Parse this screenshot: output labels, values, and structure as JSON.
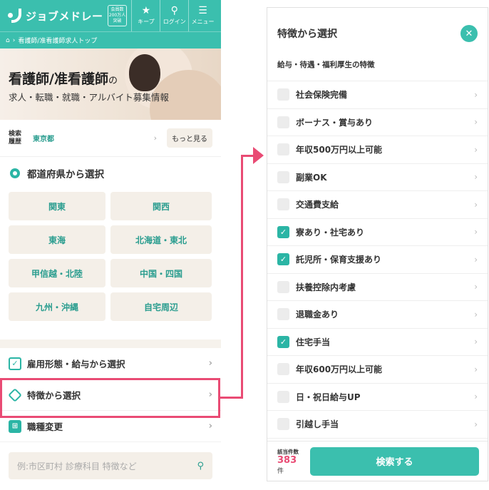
{
  "header": {
    "logo_text": "ジョブメドレー",
    "members_badge": [
      "会員数",
      "200万人",
      "突破"
    ],
    "keep_label": "キープ",
    "login_label": "ログイン",
    "menu_label": "メニュー"
  },
  "breadcrumb": {
    "home_icon": "home-icon",
    "text": "看護師/准看護師求人トップ"
  },
  "hero": {
    "title": "看護師/准看護師",
    "title_suffix": "の",
    "subtitle": "求人・転職・就職・アルバイト募集情報"
  },
  "history": {
    "label_line1": "検索",
    "label_line2": "履歴",
    "value": "東京都",
    "more_label": "もっと見る"
  },
  "prefecture": {
    "title": "都道府県から選択",
    "regions": [
      "関東",
      "関西",
      "東海",
      "北海道・東北",
      "甲信越・北陸",
      "中国・四国",
      "九州・沖縄",
      "自宅周辺"
    ]
  },
  "menu": {
    "employment": "雇用形態・給与から選択",
    "features": "特徴から選択",
    "job_type": "職種変更"
  },
  "search": {
    "placeholder": "例:市区町村 診療科目 特徴など"
  },
  "modal": {
    "title": "特徴から選択",
    "group_title": "給与・待遇・福利厚生の特徴",
    "items": [
      {
        "label": "社会保険完備",
        "checked": false
      },
      {
        "label": "ボーナス・賞与あり",
        "checked": false
      },
      {
        "label": "年収500万円以上可能",
        "checked": false
      },
      {
        "label": "副業OK",
        "checked": false
      },
      {
        "label": "交通費支給",
        "checked": false
      },
      {
        "label": "寮あり・社宅あり",
        "checked": true
      },
      {
        "label": "託児所・保育支援あり",
        "checked": true
      },
      {
        "label": "扶養控除内考慮",
        "checked": false
      },
      {
        "label": "退職金あり",
        "checked": false
      },
      {
        "label": "住宅手当",
        "checked": true
      },
      {
        "label": "年収600万円以上可能",
        "checked": false
      },
      {
        "label": "日・祝日給与UP",
        "checked": false
      },
      {
        "label": "引越し手当",
        "checked": false
      }
    ],
    "count_label": "該当件数",
    "count": "383",
    "count_unit": "件",
    "search_button": "検索する"
  },
  "colors": {
    "brand": "#3bbfae",
    "highlight": "#e94b74",
    "accent_text": "#2a9d8f"
  }
}
